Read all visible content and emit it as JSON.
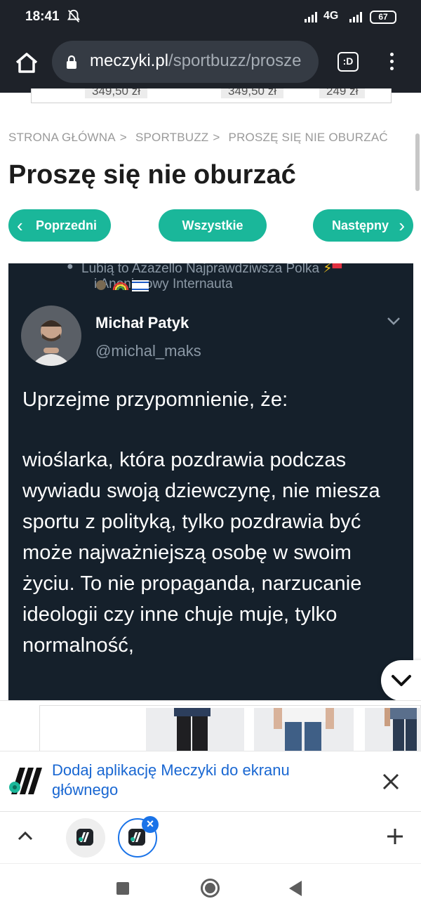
{
  "status_bar": {
    "time": "18:41",
    "network": "4G",
    "battery": "67"
  },
  "browser": {
    "url_domain": "meczyki.pl",
    "url_path": "/sportbuzz/prosze",
    "tabs_label": ":D"
  },
  "ad_strip": {
    "prices": [
      "349,50 zł",
      "349,50 zł",
      "249 zł"
    ]
  },
  "breadcrumb": {
    "items": [
      "STRONA GŁÓWNA",
      "SPORTBUZZ",
      "PROSZĘ SIĘ NIE OBURZAĆ"
    ]
  },
  "article": {
    "title": "Proszę się nie oburzać"
  },
  "nav": {
    "prev": "Poprzedni",
    "all": "Wszystkie",
    "next": "Następny"
  },
  "tweet": {
    "liked_by_line1": "Lubią to Azazello Najprawdziwsza Polka",
    "liked_by_line2": "i Anonimowy Internauta",
    "author_name": "Michał Patyk",
    "author_handle": "@michal_maks",
    "text_p1": "Uprzejme przypomnienie, że:",
    "text_p2": "wioślarka, która pozdrawia podczas wywiadu swoją dziewczynę, nie miesza sportu z polityką, tylko pozdrawia być może najważniejszą osobę w swoim życiu. To nie propaganda, narzucanie ideologii czy inne chuje muje, tylko normalność,"
  },
  "install_banner": {
    "text": "Dodaj aplikację Meczyki do ekranu głównego"
  },
  "colors": {
    "accent": "#1ab79a",
    "browser_bar": "#1e2229",
    "tweet_bg": "#15202b",
    "link_blue": "#1967d2"
  }
}
